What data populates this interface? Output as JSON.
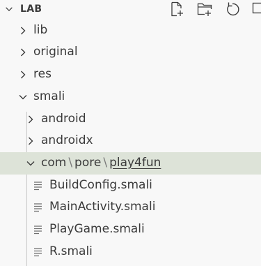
{
  "explorer": {
    "section_title": "LAB",
    "actions": [
      {
        "name": "new-file-icon"
      },
      {
        "name": "new-folder-icon"
      },
      {
        "name": "refresh-icon"
      },
      {
        "name": "collapse-all-icon"
      }
    ]
  },
  "tree": {
    "lib": "lib",
    "original": "original",
    "res": "res",
    "smali": "smali",
    "android": "android",
    "androidx": "androidx",
    "compact_path": {
      "seg1": "com",
      "seg2": "pore",
      "seg3": "play4fun",
      "separator": "\\"
    },
    "files": {
      "f1": "BuildConfig.smali",
      "f2": "MainActivity.smali",
      "f3": "PlayGame.smali",
      "f4": "R.smali"
    }
  },
  "colors": {
    "background": "#f8f8f8",
    "selected_row": "#dde3d8",
    "text": "#3b3b3b",
    "indent_guide": "#c8c8c8"
  }
}
